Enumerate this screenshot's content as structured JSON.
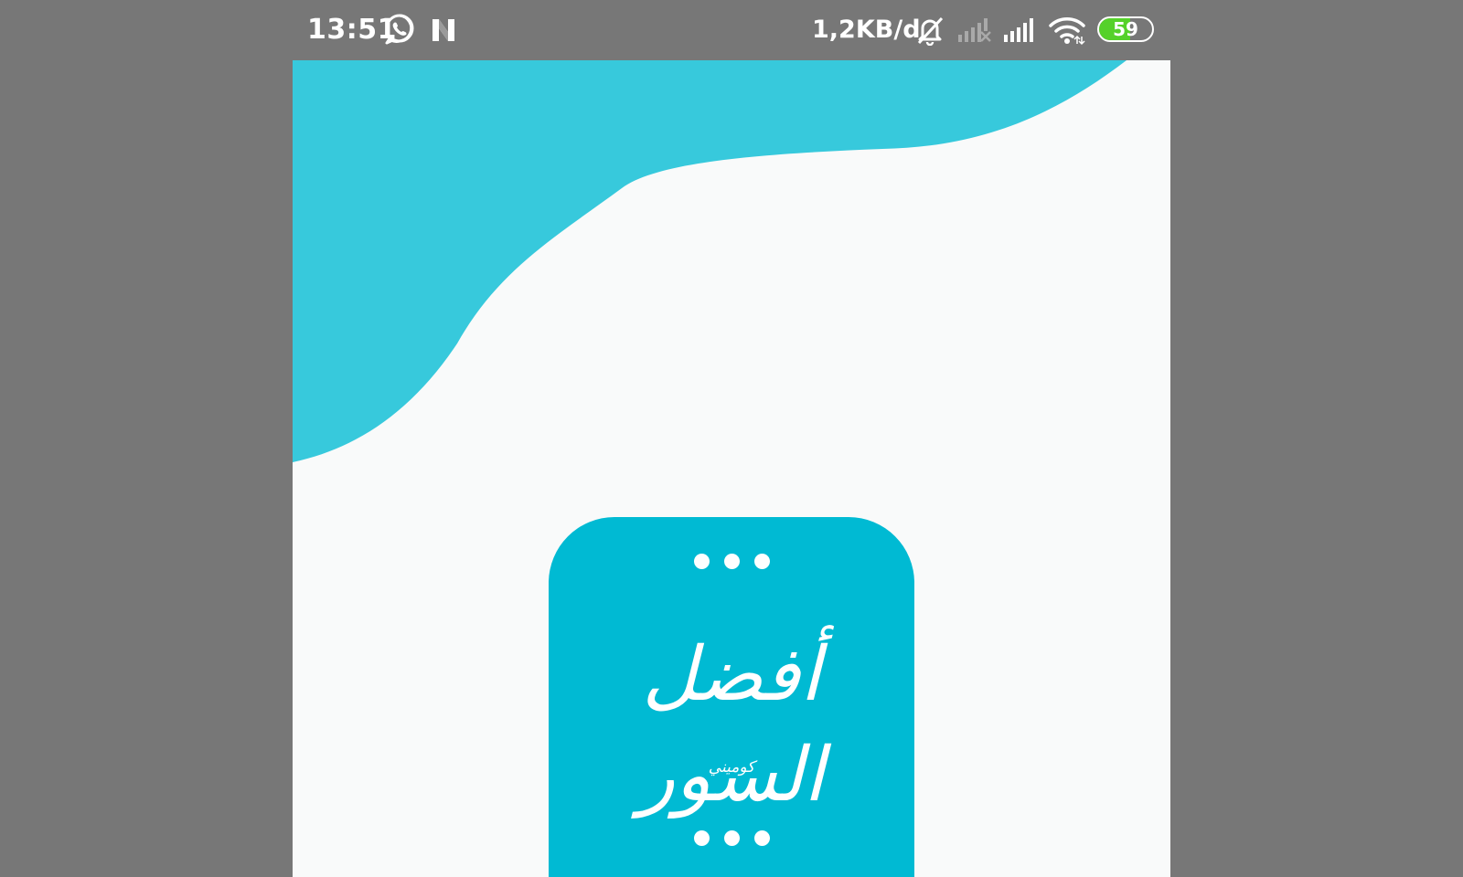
{
  "status_bar": {
    "time": "13:51",
    "network_speed": "1,2KB/d",
    "battery_level": "59",
    "battery_fraction": 0.59,
    "icons": [
      "whatsapp-icon",
      "n-notification-icon",
      "mute-icon",
      "signal-no-service-icon",
      "signal-icon",
      "wifi-icon"
    ]
  },
  "colors": {
    "status_bar_bg": "#777777",
    "screen_bg": "#f9fafa",
    "wave": "#37c9dc",
    "logo_bg": "#00bad3",
    "battery": "#55d12a"
  },
  "splash": {
    "logo_title": "أفضل السور",
    "logo_subtitle": "كوميني"
  }
}
